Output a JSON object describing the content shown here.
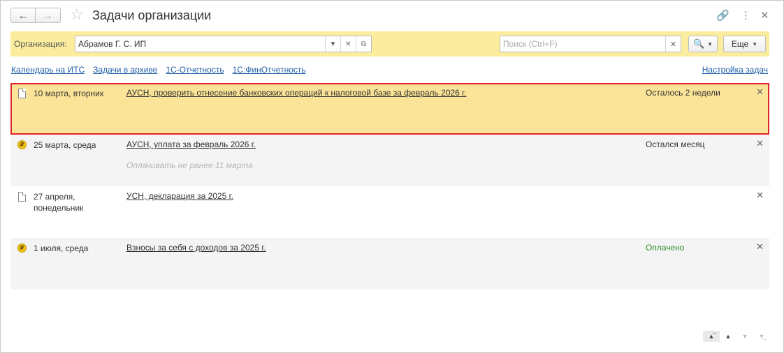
{
  "window": {
    "title": "Задачи организации"
  },
  "filter": {
    "org_label": "Организация:",
    "org_value": "Абрамов Г. С. ИП",
    "search_placeholder": "Поиск (Ctrl+F)",
    "more_label": "Еще"
  },
  "links": {
    "items": [
      {
        "label": "Календарь на ИТС"
      },
      {
        "label": "Задачи в архиве"
      },
      {
        "label": "1С-Отчетность"
      },
      {
        "label": "1С:ФинОтчетность"
      }
    ],
    "settings": "Настройка задач"
  },
  "tasks": [
    {
      "icon": "document-icon",
      "date": "10 марта, вторник",
      "name": "АУСН, проверить отнесение банковских операций к налоговой базе за февраль 2026 г.",
      "note": "",
      "status": "Осталось 2 недели",
      "selected": true
    },
    {
      "icon": "ruble-coin-icon",
      "date": "25 марта, среда",
      "name": "АУСН, уплата за февраль 2026 г.",
      "note": "Оплачивать не ранее 11 марта",
      "status": "Остался месяц"
    },
    {
      "icon": "document-icon",
      "date": "27 апреля, понедельник",
      "name": "УСН, декларация за 2025 г.",
      "note": "",
      "status": ""
    },
    {
      "icon": "ruble-coin-icon",
      "date": "1 июля, среда",
      "name": "Взносы за себя с доходов за 2025 г.",
      "note": "",
      "status": "Оплачено"
    }
  ],
  "colors": {
    "filter_bg": "#fbec9e",
    "selected_bg": "#fbe497",
    "selected_border": "#e0262b",
    "link": "#1f5fa8",
    "paid": "#2e8b2e"
  }
}
